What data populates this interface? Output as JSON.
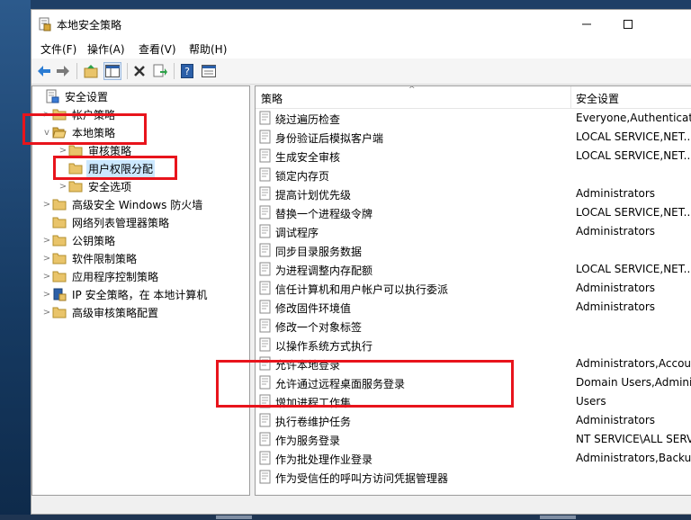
{
  "window": {
    "title": "本地安全策略"
  },
  "menu": [
    "文件(F)",
    "操作(A)",
    "查看(V)",
    "帮助(H)"
  ],
  "toolbar": [
    {
      "name": "back-arrow-icon"
    },
    {
      "name": "forward-arrow-icon"
    },
    {
      "name": "up-folder-icon"
    },
    {
      "name": "show-hide-console-tree-icon"
    },
    {
      "name": "delete-icon"
    },
    {
      "name": "export-list-icon"
    },
    {
      "name": "help-icon"
    },
    {
      "name": "properties-icon"
    }
  ],
  "tree": [
    {
      "label": "安全设置",
      "icon": "security-settings-icon",
      "expander": ""
    },
    {
      "label": "帐户策略",
      "icon": "folder-icon",
      "expander": ">"
    },
    {
      "label": "本地策略",
      "icon": "folder-open-icon",
      "expander": "v"
    },
    {
      "label": "审核策略",
      "icon": "folder-icon",
      "expander": ">"
    },
    {
      "label": "用户权限分配",
      "icon": "folder-icon",
      "expander": "",
      "selected": true
    },
    {
      "label": "安全选项",
      "icon": "folder-icon",
      "expander": ">"
    },
    {
      "label": "高级安全 Windows 防火墙",
      "icon": "folder-icon",
      "expander": ">"
    },
    {
      "label": "网络列表管理器策略",
      "icon": "folder-icon",
      "expander": ""
    },
    {
      "label": "公钥策略",
      "icon": "folder-icon",
      "expander": ">"
    },
    {
      "label": "软件限制策略",
      "icon": "folder-icon",
      "expander": ">"
    },
    {
      "label": "应用程序控制策略",
      "icon": "folder-icon",
      "expander": ">"
    },
    {
      "label": "IP 安全策略，在 本地计算机",
      "icon": "ip-security-icon",
      "expander": ">"
    },
    {
      "label": "高级审核策略配置",
      "icon": "folder-icon",
      "expander": ">"
    }
  ],
  "columns": {
    "policy": "策略",
    "setting": "安全设置"
  },
  "policies": [
    {
      "name": "绕过遍历检查",
      "value": "Everyone,Authenticate..."
    },
    {
      "name": "身份验证后模拟客户端",
      "value": "LOCAL SERVICE,NET..."
    },
    {
      "name": "生成安全审核",
      "value": "LOCAL SERVICE,NET..."
    },
    {
      "name": "锁定内存页",
      "value": ""
    },
    {
      "name": "提高计划优先级",
      "value": "Administrators"
    },
    {
      "name": "替换一个进程级令牌",
      "value": "LOCAL SERVICE,NET..."
    },
    {
      "name": "调试程序",
      "value": "Administrators"
    },
    {
      "name": "同步目录服务数据",
      "value": ""
    },
    {
      "name": "为进程调整内存配额",
      "value": "LOCAL SERVICE,NET..."
    },
    {
      "name": "信任计算机和用户帐户可以执行委派",
      "value": "Administrators"
    },
    {
      "name": "修改固件环境值",
      "value": "Administrators"
    },
    {
      "name": "修改一个对象标签",
      "value": ""
    },
    {
      "name": "以操作系统方式执行",
      "value": ""
    },
    {
      "name": "允许本地登录",
      "value": "Administrators,Accou..."
    },
    {
      "name": "允许通过远程桌面服务登录",
      "value": "Domain Users,Admini..."
    },
    {
      "name": "增加进程工作集",
      "value": "Users"
    },
    {
      "name": "执行卷维护任务",
      "value": "Administrators"
    },
    {
      "name": "作为服务登录",
      "value": "NT SERVICE\\ALL SERV..."
    },
    {
      "name": "作为批处理作业登录",
      "value": "Administrators,Backu..."
    },
    {
      "name": "作为受信任的呼叫方访问凭据管理器",
      "value": ""
    }
  ],
  "colors": {
    "highlight": "#e8141c",
    "selection": "#cce8ff",
    "folder": "#e9c46a"
  }
}
